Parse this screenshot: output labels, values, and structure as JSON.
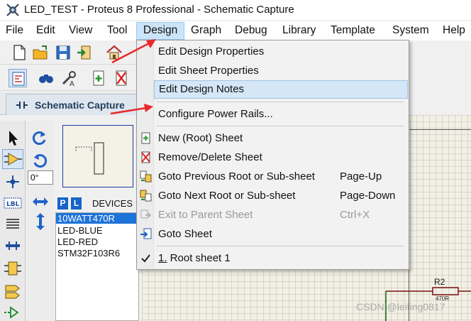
{
  "window": {
    "title": "LED_TEST - Proteus 8 Professional - Schematic Capture"
  },
  "menubar": {
    "items": [
      "File",
      "Edit",
      "View",
      "Tool",
      "Design",
      "Graph",
      "Debug",
      "Library",
      "Template",
      "System",
      "Help"
    ],
    "active": "Design"
  },
  "tab": {
    "label": "Schematic Capture"
  },
  "rotation": {
    "angle": "0°"
  },
  "devices": {
    "p_label": "P",
    "l_label": "L",
    "header": "DEVICES",
    "items": [
      "10WATT470R",
      "LED-BLUE",
      "LED-RED",
      "STM32F103R6"
    ],
    "selected": "10WATT470R"
  },
  "dropdown": {
    "items": [
      {
        "label": "Edit Design Properties",
        "shortcut": "",
        "icon": "",
        "state": "normal"
      },
      {
        "label": "Edit Sheet Properties",
        "shortcut": "",
        "icon": "",
        "state": "normal"
      },
      {
        "label": "Edit Design Notes",
        "shortcut": "",
        "icon": "",
        "state": "highlighted"
      },
      {
        "label": "Configure Power Rails...",
        "shortcut": "",
        "icon": "",
        "state": "normal"
      },
      {
        "label": "New (Root) Sheet",
        "shortcut": "",
        "icon": "new-sheet-icon",
        "state": "normal"
      },
      {
        "label": "Remove/Delete Sheet",
        "shortcut": "",
        "icon": "delete-sheet-icon",
        "state": "normal"
      },
      {
        "label": "Goto Previous Root or Sub-sheet",
        "shortcut": "Page-Up",
        "icon": "previous-sheet-icon",
        "state": "normal"
      },
      {
        "label": "Goto Next Root or Sub-sheet",
        "shortcut": "Page-Down",
        "icon": "next-sheet-icon",
        "state": "normal"
      },
      {
        "label": "Exit to Parent Sheet",
        "shortcut": "Ctrl+X",
        "icon": "parent-sheet-icon",
        "state": "disabled"
      },
      {
        "label": "Goto Sheet",
        "shortcut": "",
        "icon": "goto-sheet-icon",
        "state": "normal"
      },
      {
        "label_prefix": "1.",
        "label_rest": " Root sheet 1",
        "shortcut": "",
        "icon": "checkmark-icon",
        "state": "checked"
      }
    ]
  },
  "canvas": {
    "component_ref": "R2",
    "component_value": "470R"
  },
  "watermark": "CSDN @leiting0817",
  "colors": {
    "menu_highlight": "#d5e6f6",
    "device_selected": "#1e73d8",
    "arrow": "#e8282c",
    "canvas_bg": "#f2f0e4"
  }
}
